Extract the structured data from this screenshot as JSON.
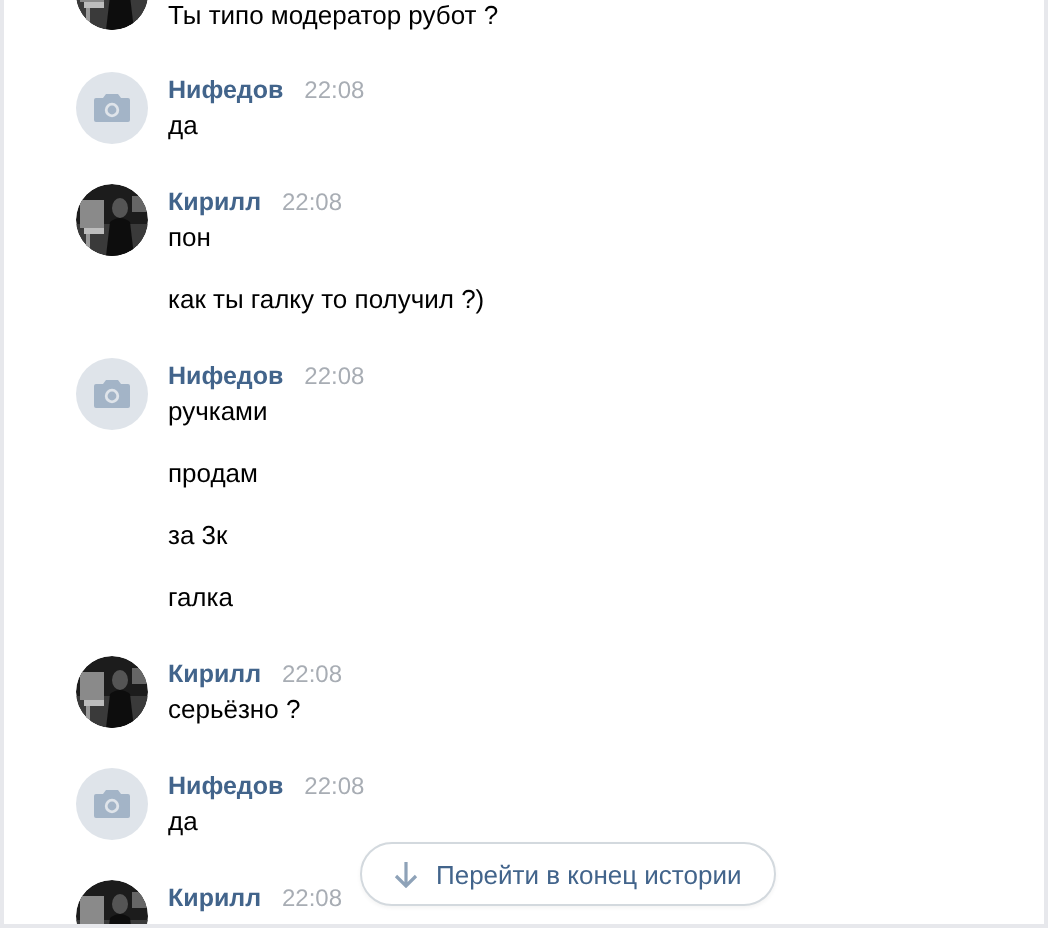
{
  "groups": [
    {
      "has_photo": true,
      "messages": [
        "Ты типо модератор рубот ?"
      ]
    },
    {
      "author": "Нифедов",
      "time": "22:08",
      "has_photo": false,
      "messages": [
        "да"
      ]
    },
    {
      "author": "Кирилл",
      "time": "22:08",
      "has_photo": true,
      "messages": [
        "пон",
        "как ты галку то получил ?)"
      ]
    },
    {
      "author": "Нифедов",
      "time": "22:08",
      "has_photo": false,
      "messages": [
        "ручками",
        "продам",
        "за 3к",
        "галка"
      ]
    },
    {
      "author": "Кирилл",
      "time": "22:08",
      "has_photo": true,
      "messages": [
        "серьёзно ?"
      ]
    },
    {
      "author": "Нифедов",
      "time": "22:08",
      "has_photo": false,
      "messages": [
        "да"
      ]
    },
    {
      "author": "Кирилл",
      "time": "22:08",
      "has_photo": true
    }
  ],
  "jump_button": {
    "label": "Перейти в конец истории"
  }
}
